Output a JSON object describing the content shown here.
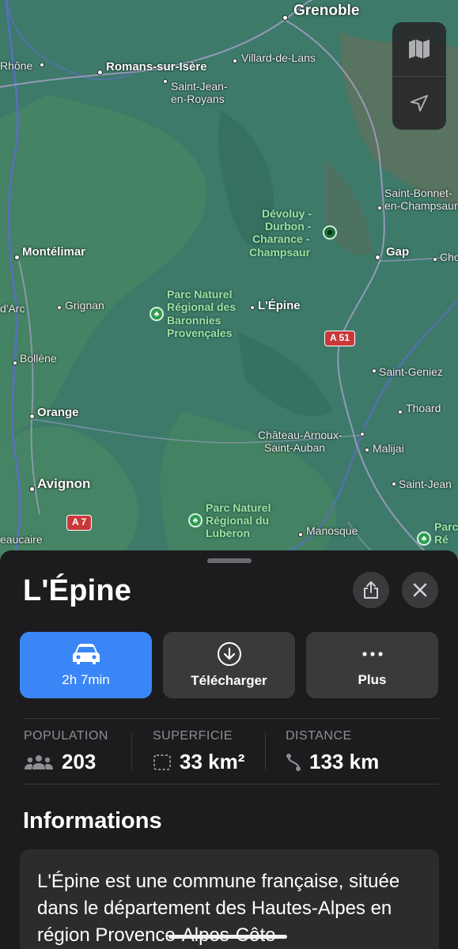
{
  "map": {
    "labels": {
      "grenoble": "Grenoble",
      "rhone": "Rhône",
      "romans": "Romans-sur-Isère",
      "villard": "Villard-de-Lans",
      "saint_jean_1": "Saint-Jean-",
      "saint_jean_2": "en-Royans",
      "saint_bonnet_1": "Saint-Bonnet-",
      "saint_bonnet_2": "en-Champsaur",
      "devoluy_1": "Dévoluy -",
      "devoluy_2": "Durbon -",
      "devoluy_3": "Charance -",
      "devoluy_4": "Champsaur",
      "montelimar": "Montélimar",
      "gap": "Gap",
      "chorges": "Cho",
      "darc": "d'Arc",
      "grignan": "Grignan",
      "baronnies_1": "Parc Naturel",
      "baronnies_2": "Régional des",
      "baronnies_3": "Baronnies",
      "baronnies_4": "Provençales",
      "lepine": "L'Épine",
      "bollene": "Bollène",
      "saint_geniez": "Saint-Geniez",
      "orange": "Orange",
      "thoard": "Thoard",
      "chateau_1": "Château-Arnoux-",
      "chateau_2": "Saint-Auban",
      "malijai": "Malijai",
      "avignon": "Avignon",
      "saint_jean_2nd": "Saint-Jean",
      "luberon_1": "Parc Naturel",
      "luberon_2": "Régional du",
      "luberon_3": "Luberon",
      "manosque": "Manosque",
      "beaucaire": "eaucaire",
      "parc_r_1": "Parc",
      "parc_r_2": "Ré"
    },
    "road_shields": {
      "a51": "A 51",
      "a7": "A 7"
    },
    "controls": {
      "map_mode_icon": "map-icon",
      "locate_icon": "location-arrow-icon"
    }
  },
  "sheet": {
    "title": "L'Épine",
    "share_icon": "share-icon",
    "close_icon": "close-icon",
    "actions": [
      {
        "label": "2h 7min",
        "icon": "car-icon",
        "color": "#3a86f7"
      },
      {
        "label": "Télécharger",
        "icon": "download-icon"
      },
      {
        "label": "Plus",
        "icon": "more-icon"
      }
    ],
    "stats": [
      {
        "key": "POPULATION",
        "value": "203",
        "icon": "people-icon"
      },
      {
        "key": "SUPERFICIE",
        "value": "33 km²",
        "icon": "area-icon"
      },
      {
        "key": "DISTANCE",
        "value": "133 km",
        "icon": "route-icon"
      }
    ],
    "info_title": "Informations",
    "info_text": "L'Épine est une commune française, située dans le département des Hautes-Alpes en région Provence-Alpes-Côte"
  }
}
